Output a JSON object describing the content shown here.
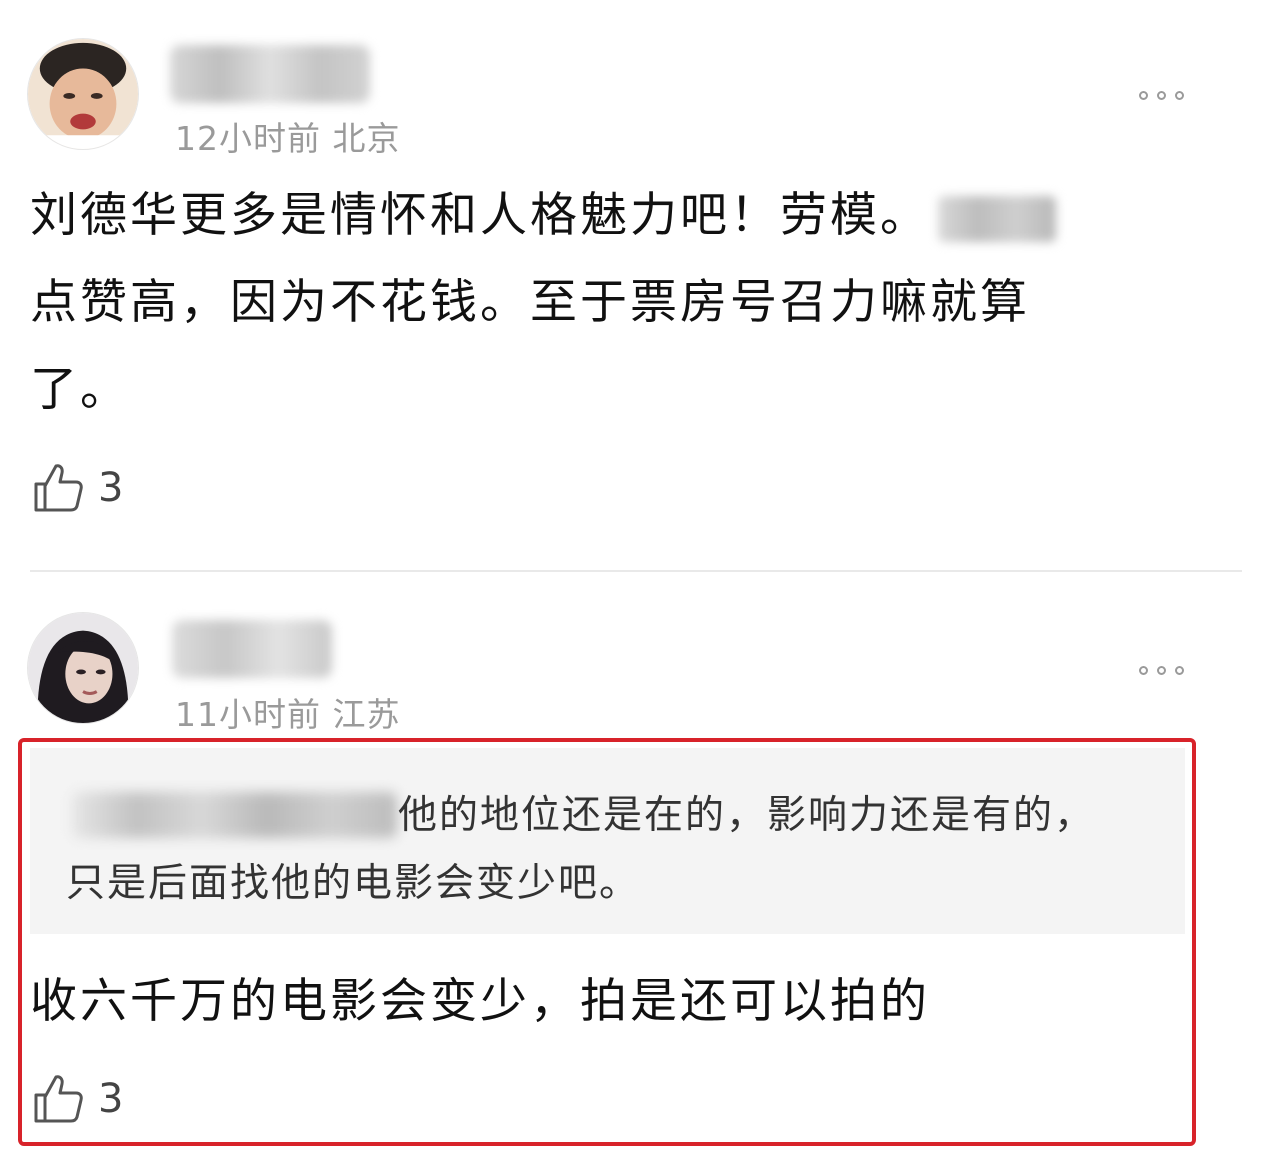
{
  "comments": [
    {
      "avatar_icon": "child-face-avatar",
      "meta": "12小时前 北京",
      "body_lines": [
        "刘德华更多是情怀和人格魅力吧！劳模。",
        "点赞高，因为不花钱。至于票房号召力嘛就算",
        "了。"
      ],
      "like_count": "3"
    },
    {
      "avatar_icon": "woman-portrait-avatar",
      "meta": "11小时前 江苏",
      "quote_lines": [
        "他的地位还是在的，影响力还是有的，",
        "只是后面找他的电影会变少吧。"
      ],
      "body": "收六千万的电影会变少，拍是还可以拍的",
      "like_count": "3"
    }
  ],
  "highlight_color": "#d8232a"
}
